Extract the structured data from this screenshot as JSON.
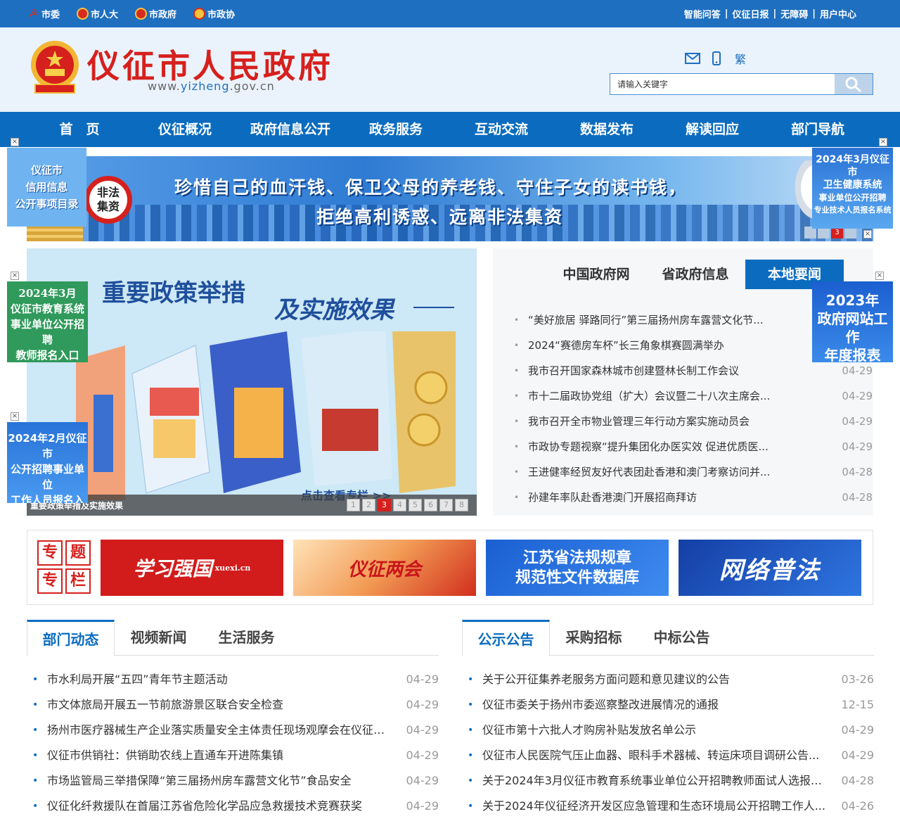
{
  "topbar": {
    "links": [
      {
        "label": "市委",
        "icon": "party-flag-icon"
      },
      {
        "label": "市人大",
        "icon": "emblem-icon"
      },
      {
        "label": "市政府",
        "icon": "emblem-icon"
      },
      {
        "label": "市政协",
        "icon": "cppcc-emblem-icon"
      }
    ],
    "right": [
      "智能问答",
      "仪征日报",
      "无障碍",
      "用户中心"
    ]
  },
  "header": {
    "title": "仪征市人民政府",
    "url_prefix": "www.",
    "url_main": "yizheng",
    "url_suffix": ".gov.cn",
    "icons": [
      "mail-icon",
      "mobile-icon"
    ],
    "trad_label": "繁",
    "search_placeholder": "请输入关键字"
  },
  "nav": [
    "首　页",
    "仪征概况",
    "政府信息公开",
    "政务服务",
    "互动交流",
    "数据发布",
    "解读回应",
    "部门导航"
  ],
  "banner": {
    "badge": "非法\n集资",
    "line1": "珍惜自己的血汗钱、保卫父母的养老钱、守住子女的读书钱，",
    "line2": "拒绝高利诱惑、远离非法集资",
    "pager": [
      "",
      "",
      "3",
      ""
    ],
    "active_page": "3"
  },
  "floats": {
    "left1": [
      "仪征市",
      "信用信息",
      "公开事项目录"
    ],
    "right1": [
      "2024年3月仪征市",
      "卫生健康系统",
      "事业单位公开招聘",
      "专业技术人员报名系统"
    ],
    "left2": [
      "2024年3月",
      "仪征市教育系统",
      "事业单位公开招聘",
      "教师报名入口"
    ],
    "right2": [
      "2023年",
      "政府网站工作",
      "年度报表"
    ],
    "left3": [
      "2024年2月仪征市",
      "公开招聘事业单位",
      "工作人员报名入口"
    ]
  },
  "feature": {
    "title1": "重要政策举措",
    "title2": "及实施效果",
    "more": "点击查看专栏 >>",
    "caption": "重要政策举措及实施效果",
    "pager": [
      "1",
      "2",
      "3",
      "4",
      "5",
      "6",
      "7",
      "8"
    ],
    "active_page": "3"
  },
  "news": {
    "tabs": [
      "中国政府网",
      "省政府信息",
      "本地要闻"
    ],
    "active_tab": "本地要闻",
    "items": [
      {
        "title": "“美好旅居 驿路同行”第三届扬州房车露营文化节...",
        "date": ""
      },
      {
        "title": "2024“赛德房车杯”长三角象棋赛圆满举办",
        "date": ""
      },
      {
        "title": "我市召开国家森林城市创建暨林长制工作会议",
        "date": "04-29"
      },
      {
        "title": "市十二届政协党组（扩大）会议暨二十八次主席会...",
        "date": "04-29"
      },
      {
        "title": "我市召开全市物业管理三年行动方案实施动员会",
        "date": "04-29"
      },
      {
        "title": "市政协专题视察“提升集团化办医实效 促进优质医...",
        "date": "04-29"
      },
      {
        "title": "王进健率经贸友好代表团赴香港和澳门考察访问并...",
        "date": "04-28"
      },
      {
        "title": "孙建年率队赴香港澳门开展招商拜访",
        "date": "04-28"
      }
    ]
  },
  "special": {
    "label": [
      "专",
      "题",
      "专",
      "栏"
    ],
    "b1": "学习强国",
    "b1_small": "xuexi.cn",
    "b2": "仪征两会",
    "b3_line1": "江苏省法规规章",
    "b3_line2": "规范性文件数据库",
    "b4": "网络普法"
  },
  "dept": {
    "tabs": [
      "部门动态",
      "视频新闻",
      "生活服务"
    ],
    "active_tab": "部门动态",
    "items": [
      {
        "title": "市水利局开展“五四”青年节主题活动",
        "date": "04-29"
      },
      {
        "title": "市文体旅局开展五一节前旅游景区联合安全检查",
        "date": "04-29"
      },
      {
        "title": "扬州市医疗器械生产企业落实质量安全主体责任现场观摩会在仪征召...",
        "date": "04-29"
      },
      {
        "title": "仪征市供销社：供销助农线上直通车开进陈集镇",
        "date": "04-29"
      },
      {
        "title": "市场监管局三举措保障“第三届扬州房车露营文化节”食品安全",
        "date": "04-29"
      },
      {
        "title": "仪征化纤救援队在首届江苏省危险化学品应急救援技术竞赛获奖",
        "date": "04-29"
      }
    ]
  },
  "notice": {
    "tabs": [
      "公示公告",
      "采购招标",
      "中标公告"
    ],
    "active_tab": "公示公告",
    "items": [
      {
        "title": "关于公开征集养老服务方面问题和意见建议的公告",
        "date": "03-26"
      },
      {
        "title": "仪征市委关于扬州市委巡察整改进展情况的通报",
        "date": "12-15"
      },
      {
        "title": "仪征市第十六批人才购房补贴发放名单公示",
        "date": "04-29"
      },
      {
        "title": "仪征市人民医院气压止血器、眼科手术器械、转运床项目调研公告...",
        "date": "04-29"
      },
      {
        "title": "关于2024年3月仪征市教育系统事业单位公开招聘教师面试人选报考...",
        "date": "04-28"
      },
      {
        "title": "关于2024年仪征经济开发区应急管理和生态环境局公开招聘工作人...",
        "date": "04-26"
      }
    ]
  },
  "colors": {
    "primary": "#0b6cbf",
    "topbar": "#1e6fc0",
    "title_red": "#d6201d"
  }
}
